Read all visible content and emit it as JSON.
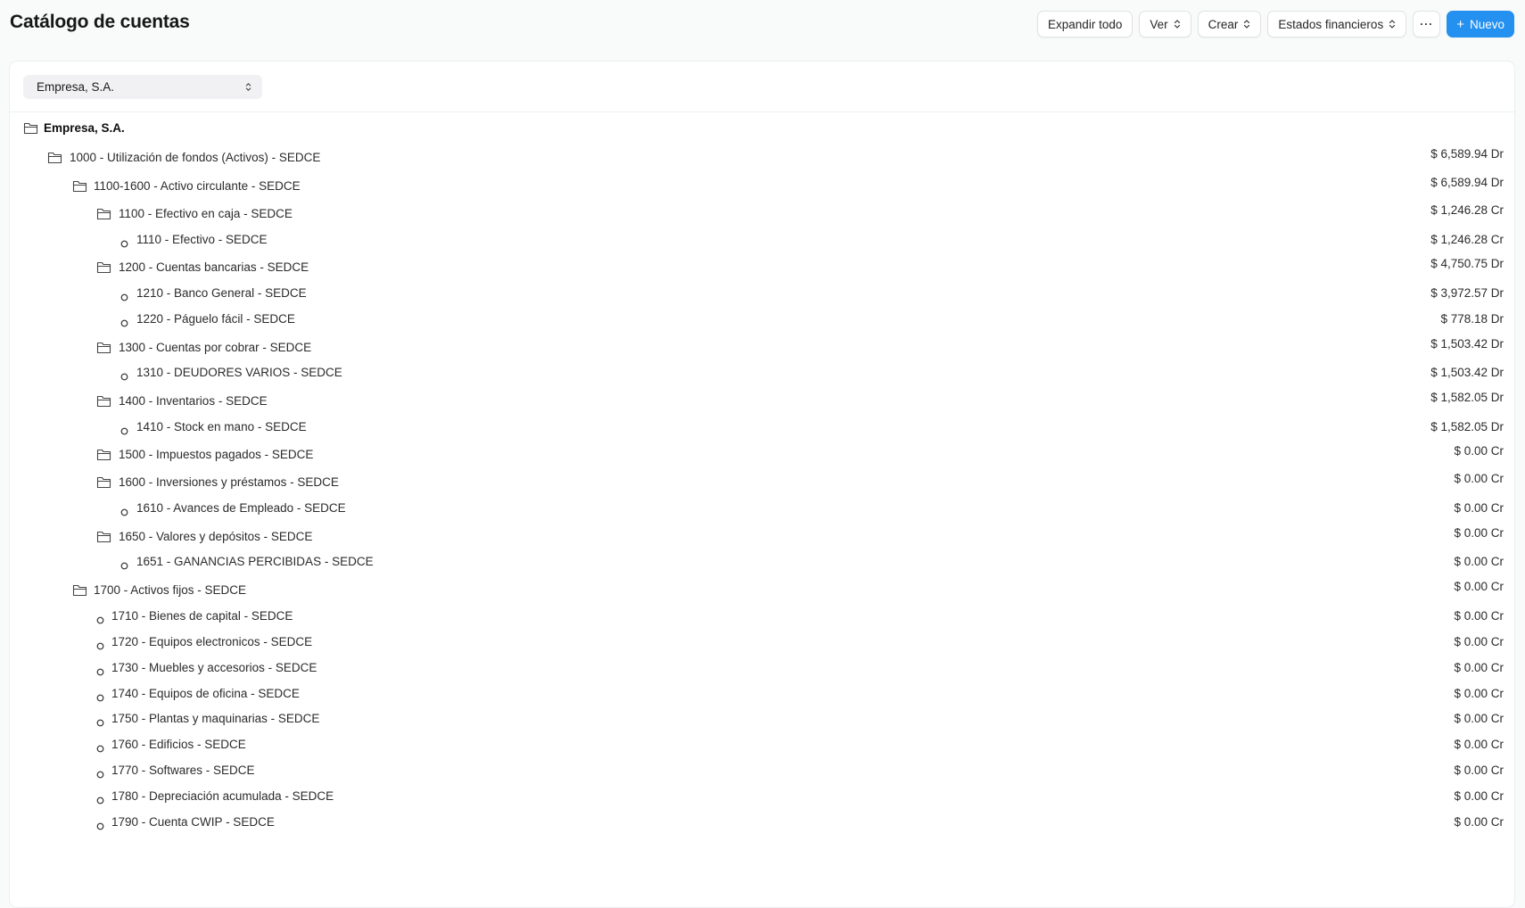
{
  "header": {
    "title": "Catálogo de cuentas",
    "expand_all": "Expandir todo",
    "view": "Ver",
    "create": "Crear",
    "financial_statements": "Estados financieros",
    "more": "···",
    "new": "Nuevo"
  },
  "filter": {
    "company": "Empresa, S.A."
  },
  "colors": {
    "primary": "#2490ef",
    "text": "#2b2b2b"
  },
  "tree": {
    "root": "Empresa, S.A.",
    "rows": [
      {
        "label": "1000 - Utilización de fondos (Activos) - SEDCE",
        "balance": "$ 6,589.94 Dr",
        "type": "folder"
      },
      {
        "label": "1100-1600 - Activo circulante - SEDCE",
        "balance": "$ 6,589.94 Dr",
        "type": "folder"
      },
      {
        "label": "1100 - Efectivo en caja - SEDCE",
        "balance": "$ 1,246.28 Cr",
        "type": "folder"
      },
      {
        "label": "1110 - Efectivo - SEDCE",
        "balance": "$ 1,246.28 Cr",
        "type": "leaf"
      },
      {
        "label": "1200 - Cuentas bancarias - SEDCE",
        "balance": "$ 4,750.75 Dr",
        "type": "folder"
      },
      {
        "label": "1210 - Banco General - SEDCE",
        "balance": "$ 3,972.57 Dr",
        "type": "leaf"
      },
      {
        "label": "1220 - Páguelo fácil - SEDCE",
        "balance": "$ 778.18 Dr",
        "type": "leaf"
      },
      {
        "label": "1300 - Cuentas por cobrar - SEDCE",
        "balance": "$ 1,503.42 Dr",
        "type": "folder"
      },
      {
        "label": "1310 - DEUDORES VARIOS - SEDCE",
        "balance": "$ 1,503.42 Dr",
        "type": "leaf"
      },
      {
        "label": "1400 - Inventarios - SEDCE",
        "balance": "$ 1,582.05 Dr",
        "type": "folder"
      },
      {
        "label": "1410 - Stock en mano - SEDCE",
        "balance": "$ 1,582.05 Dr",
        "type": "leaf"
      },
      {
        "label": "1500 - Impuestos pagados - SEDCE",
        "balance": "$ 0.00 Cr",
        "type": "folder"
      },
      {
        "label": "1600 - Inversiones y préstamos - SEDCE",
        "balance": "$ 0.00 Cr",
        "type": "folder"
      },
      {
        "label": "1610 - Avances de Empleado - SEDCE",
        "balance": "$ 0.00 Cr",
        "type": "leaf"
      },
      {
        "label": "1650 - Valores y depósitos - SEDCE",
        "balance": "$ 0.00 Cr",
        "type": "folder"
      },
      {
        "label": "1651 - GANANCIAS PERCIBIDAS - SEDCE",
        "balance": "$ 0.00 Cr",
        "type": "leaf"
      },
      {
        "label": "1700 - Activos fijos - SEDCE",
        "balance": "$ 0.00 Cr",
        "type": "folder"
      },
      {
        "label": "1710 - Bienes de capital - SEDCE",
        "balance": "$ 0.00 Cr",
        "type": "leaf"
      },
      {
        "label": "1720 - Equipos electronicos - SEDCE",
        "balance": "$ 0.00 Cr",
        "type": "leaf"
      },
      {
        "label": "1730 - Muebles y accesorios - SEDCE",
        "balance": "$ 0.00 Cr",
        "type": "leaf"
      },
      {
        "label": "1740 - Equipos de oficina - SEDCE",
        "balance": "$ 0.00 Cr",
        "type": "leaf"
      },
      {
        "label": "1750 - Plantas y maquinarias - SEDCE",
        "balance": "$ 0.00 Cr",
        "type": "leaf"
      },
      {
        "label": "1760 - Edificios - SEDCE",
        "balance": "$ 0.00 Cr",
        "type": "leaf"
      },
      {
        "label": "1770 - Softwares - SEDCE",
        "balance": "$ 0.00 Cr",
        "type": "leaf"
      },
      {
        "label": "1780 - Depreciación acumulada - SEDCE",
        "balance": "$ 0.00 Cr",
        "type": "leaf"
      },
      {
        "label": "1790 - Cuenta CWIP - SEDCE",
        "balance": "$ 0.00 Cr",
        "type": "leaf"
      }
    ]
  }
}
